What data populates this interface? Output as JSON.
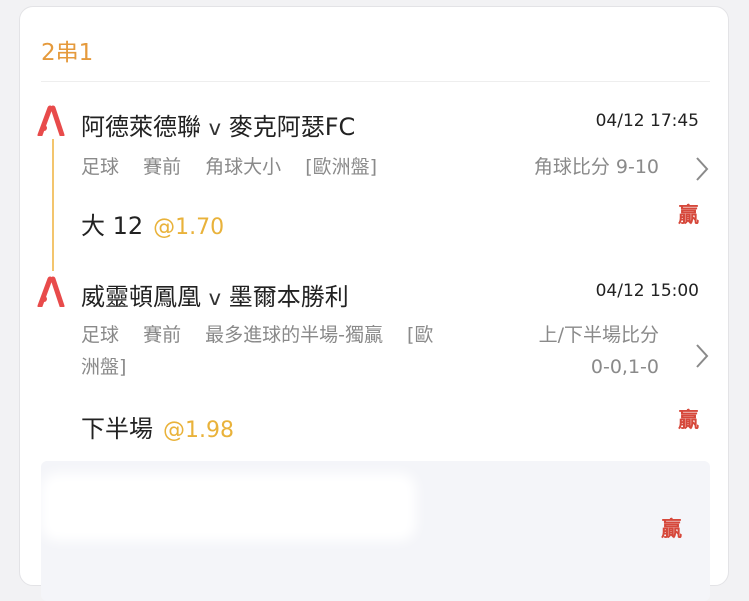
{
  "parlay": {
    "title": "2串1"
  },
  "legs": [
    {
      "home": "阿德萊德聯",
      "vs": "v",
      "away": "麥克阿瑟FC",
      "kickoff": "04/12 17:45",
      "market_tags": [
        "足球",
        "賽前",
        "角球大小",
        "[歐洲盤]"
      ],
      "result_label": "角球比分",
      "result_value": "9-10",
      "selection": "大 12",
      "odds": "@1.70",
      "status": "贏"
    },
    {
      "home": "威靈頓鳳凰",
      "vs": "v",
      "away": "墨爾本勝利",
      "kickoff": "04/12 15:00",
      "market_line1": [
        "足球",
        "賽前",
        "最多進球的半場-獨贏",
        "[歐"
      ],
      "market_line2": "洲盤]",
      "result_label": "上/下半場比分",
      "result_value": "0-0,1-0",
      "selection": "下半場",
      "odds": "@1.98",
      "status": "贏"
    }
  ],
  "third_item": {
    "status": "贏"
  },
  "colors": {
    "accent": "#e59a3c",
    "odds": "#e9b23a",
    "win": "#d6483b",
    "timeline": "#f3c56d"
  },
  "icons": {
    "leg_logo": "brand-logo-icon",
    "chevron": "chevron-right-icon"
  }
}
